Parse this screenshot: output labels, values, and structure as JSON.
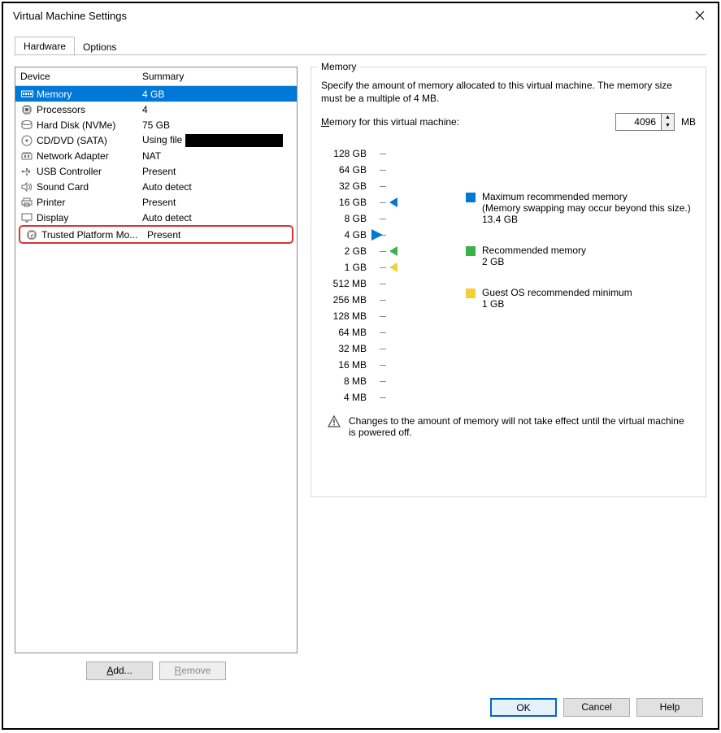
{
  "title": "Virtual Machine Settings",
  "tabs": {
    "hardware": "Hardware",
    "options": "Options"
  },
  "columns": {
    "device": "Device",
    "summary": "Summary"
  },
  "devices": [
    {
      "name": "Memory",
      "summary": "4 GB"
    },
    {
      "name": "Processors",
      "summary": "4"
    },
    {
      "name": "Hard Disk (NVMe)",
      "summary": "75 GB"
    },
    {
      "name": "CD/DVD (SATA)",
      "summary": "Using file "
    },
    {
      "name": "Network Adapter",
      "summary": "NAT"
    },
    {
      "name": "USB Controller",
      "summary": "Present"
    },
    {
      "name": "Sound Card",
      "summary": "Auto detect"
    },
    {
      "name": "Printer",
      "summary": "Present"
    },
    {
      "name": "Display",
      "summary": "Auto detect"
    },
    {
      "name": "Trusted Platform Mo...",
      "summary": "Present"
    }
  ],
  "left_buttons": {
    "add": "Add...",
    "remove": "Remove"
  },
  "memory_panel": {
    "group_title": "Memory",
    "description": "Specify the amount of memory allocated to this virtual machine. The memory size must be a multiple of 4 MB.",
    "label": "Memory for this virtual machine:",
    "value": "4096",
    "unit": "MB",
    "scale": [
      "128 GB",
      "64 GB",
      "32 GB",
      "16 GB",
      "8 GB",
      "4 GB",
      "2 GB",
      "1 GB",
      "512 MB",
      "256 MB",
      "128 MB",
      "64 MB",
      "32 MB",
      "16 MB",
      "8 MB",
      "4 MB"
    ],
    "legend": {
      "max": {
        "title": "Maximum recommended memory",
        "note": "(Memory swapping may occur beyond this size.)",
        "value": "13.4 GB"
      },
      "rec": {
        "title": "Recommended memory",
        "value": "2 GB"
      },
      "min": {
        "title": "Guest OS recommended minimum",
        "value": "1 GB"
      }
    },
    "note": "Changes to the amount of memory will not take effect until the virtual machine is powered off."
  },
  "footer": {
    "ok": "OK",
    "cancel": "Cancel",
    "help": "Help"
  }
}
